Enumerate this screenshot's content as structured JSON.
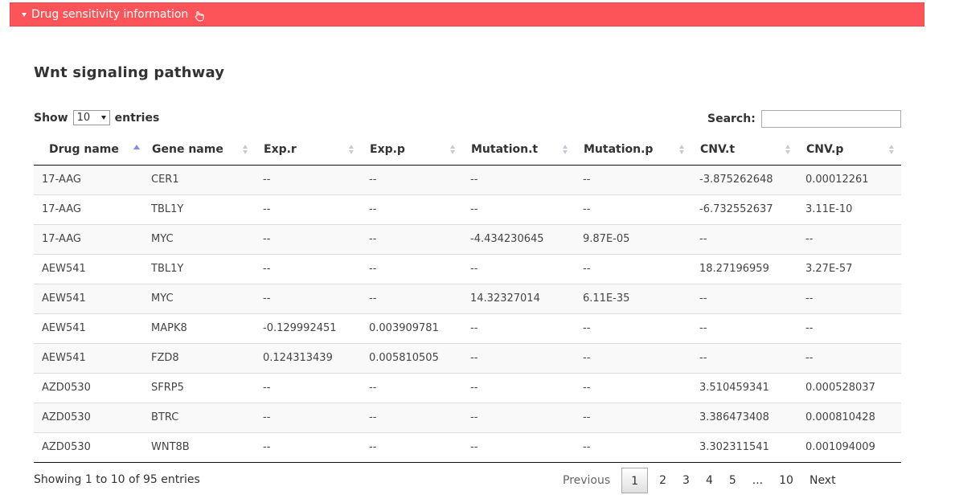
{
  "panel": {
    "title": "Drug sensitivity information",
    "icon": "hand-pointer-icon"
  },
  "section": {
    "title": "Wnt signaling pathway"
  },
  "controls": {
    "show_label": "Show",
    "length_value": "10",
    "entries_label": "entries",
    "search_label": "Search:",
    "search_value": ""
  },
  "table": {
    "columns": [
      "Drug name",
      "Gene name",
      "Exp.r",
      "Exp.p",
      "Mutation.t",
      "Mutation.p",
      "CNV.t",
      "CNV.p"
    ],
    "sorted_column": "Drug name",
    "rows": [
      [
        "17-AAG",
        "CER1",
        "--",
        "--",
        "--",
        "--",
        "-3.875262648",
        "0.00012261"
      ],
      [
        "17-AAG",
        "TBL1Y",
        "--",
        "--",
        "--",
        "--",
        "-6.732552637",
        "3.11E-10"
      ],
      [
        "17-AAG",
        "MYC",
        "--",
        "--",
        "-4.434230645",
        "9.87E-05",
        "--",
        "--"
      ],
      [
        "AEW541",
        "TBL1Y",
        "--",
        "--",
        "--",
        "--",
        "18.27196959",
        "3.27E-57"
      ],
      [
        "AEW541",
        "MYC",
        "--",
        "--",
        "14.32327014",
        "6.11E-35",
        "--",
        "--"
      ],
      [
        "AEW541",
        "MAPK8",
        "-0.129992451",
        "0.003909781",
        "--",
        "--",
        "--",
        "--"
      ],
      [
        "AEW541",
        "FZD8",
        "0.124313439",
        "0.005810505",
        "--",
        "--",
        "--",
        "--"
      ],
      [
        "AZD0530",
        "SFRP5",
        "--",
        "--",
        "--",
        "--",
        "3.510459341",
        "0.000528037"
      ],
      [
        "AZD0530",
        "BTRC",
        "--",
        "--",
        "--",
        "--",
        "3.386473408",
        "0.000810428"
      ],
      [
        "AZD0530",
        "WNT8B",
        "--",
        "--",
        "--",
        "--",
        "3.302311541",
        "0.001094009"
      ]
    ]
  },
  "footer": {
    "info": "Showing 1 to 10 of 95 entries",
    "previous": "Previous",
    "pages": [
      "1",
      "2",
      "3",
      "4",
      "5",
      "...",
      "10"
    ],
    "current_page": "1",
    "next": "Next"
  }
}
